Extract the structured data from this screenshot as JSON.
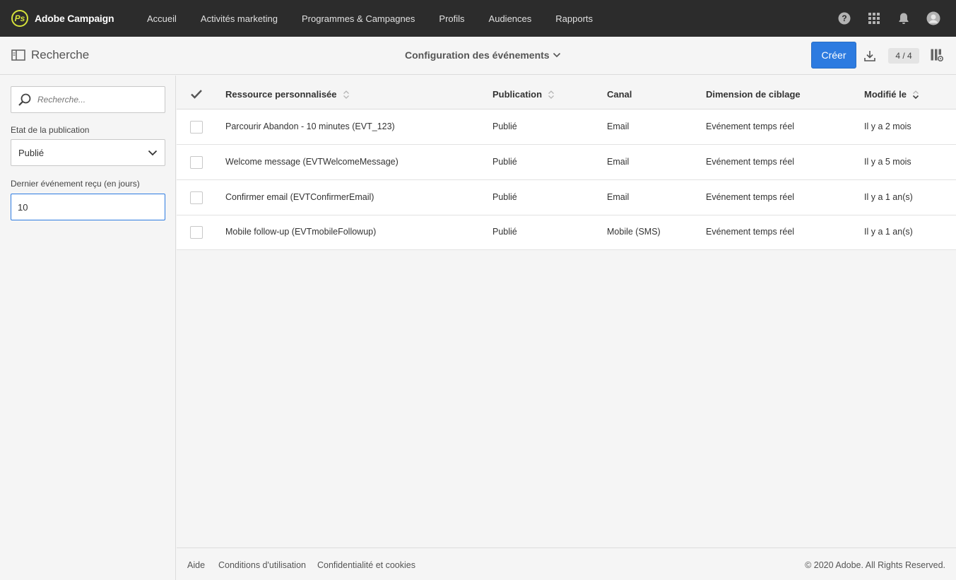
{
  "app": {
    "brand": "Adobe Campaign",
    "logo_glyph": "Ps"
  },
  "nav": {
    "items": [
      {
        "label": "Accueil"
      },
      {
        "label": "Activités marketing"
      },
      {
        "label": "Programmes & Campagnes"
      },
      {
        "label": "Profils"
      },
      {
        "label": "Audiences"
      },
      {
        "label": "Rapports"
      }
    ]
  },
  "top_icons": [
    "help-icon",
    "app-grid-icon",
    "bell-icon",
    "user-avatar-icon"
  ],
  "subheader": {
    "search_label": "Recherche",
    "title": "Configuration des événements",
    "create_label": "Créer",
    "count": "4 / 4"
  },
  "sidebar": {
    "search_placeholder": "Recherche...",
    "publication_label": "Etat de la publication",
    "publication_value": "Publié",
    "last_event_label": "Dernier événement reçu (en jours)",
    "last_event_value": "10"
  },
  "table": {
    "columns": {
      "resource": "Ressource personnalisée",
      "publication": "Publication",
      "channel": "Canal",
      "targeting": "Dimension de ciblage",
      "modified": "Modifié le"
    },
    "rows": [
      {
        "resource": "Parcourir Abandon - 10 minutes (EVT_123)",
        "publication": "Publié",
        "channel": "Email",
        "targeting": "Evénement temps réel",
        "modified": "Il y a 2 mois"
      },
      {
        "resource": "Welcome message (EVTWelcomeMessage)",
        "publication": "Publié",
        "channel": "Email",
        "targeting": "Evénement temps réel",
        "modified": "Il y a 5 mois"
      },
      {
        "resource": "Confirmer email (EVTConfirmerEmail)",
        "publication": "Publié",
        "channel": "Email",
        "targeting": "Evénement temps réel",
        "modified": "Il y a 1 an(s)"
      },
      {
        "resource": "Mobile follow-up (EVTmobileFollowup)",
        "publication": "Publié",
        "channel": "Mobile (SMS)",
        "targeting": "Evénement temps réel",
        "modified": "Il y a 1 an(s)"
      }
    ]
  },
  "footer": {
    "help": "Aide",
    "terms": "Conditions d'utilisation",
    "privacy": "Confidentialité et cookies",
    "copyright": "© 2020 Adobe. All Rights Reserved."
  },
  "colors": {
    "topbar": "#2c2c2c",
    "accent": "#2d7be0",
    "logo": "#d6e23a"
  }
}
